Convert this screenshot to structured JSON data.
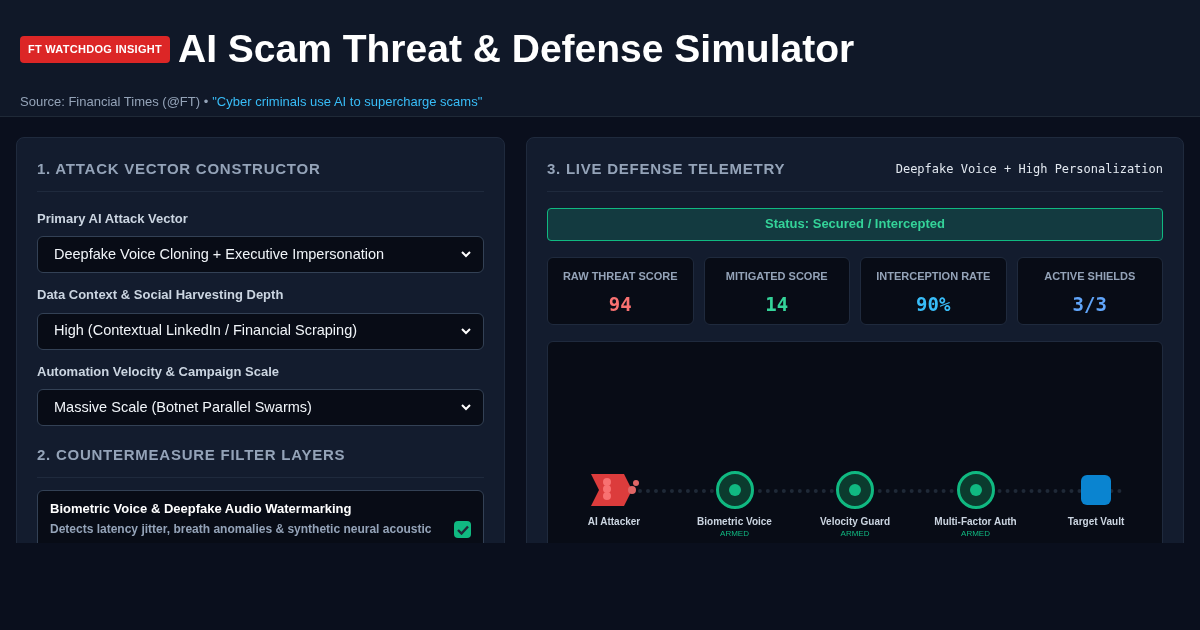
{
  "header": {
    "badge": "FT WATCHDOG INSIGHT",
    "title": "AI Scam Threat & Defense Simulator",
    "source": "Source: Financial Times (@FT) •",
    "source_link": "\"Cyber criminals use AI to supercharge scams\""
  },
  "constructor": {
    "title": "1. ATTACK VECTOR CONSTRUCTOR",
    "fields": [
      {
        "label": "Primary AI Attack Vector",
        "value": "Deepfake Voice Cloning + Executive Impersonation"
      },
      {
        "label": "Data Context & Social Harvesting Depth",
        "value": "High (Contextual LinkedIn / Financial Scraping)"
      },
      {
        "label": "Automation Velocity & Campaign Scale",
        "value": "Massive Scale (Botnet Parallel Swarms)"
      }
    ]
  },
  "filters": {
    "title": "2. COUNTERMEASURE FILTER LAYERS",
    "items": [
      {
        "name": "Biometric Voice & Deepfake Audio Watermarking",
        "description": "Detects latency jitter, breath anomalies & synthetic neural acoustic",
        "checked": true
      }
    ]
  },
  "telemetry": {
    "title": "3. LIVE DEFENSE TELEMETRY",
    "scenario": "Deepfake Voice + High Personalization",
    "status": "Status: Secured / Intercepted",
    "secured": true,
    "metrics": [
      {
        "label": "RAW THREAT SCORE",
        "value": "94",
        "color": "#f87171"
      },
      {
        "label": "MITIGATED SCORE",
        "value": "14",
        "color": "#34d399"
      },
      {
        "label": "INTERCEPTION RATE",
        "value": "90%",
        "color": "#38bdf8"
      },
      {
        "label": "ACTIVE SHIELDS",
        "value": "3/3",
        "color": "#60a5fa"
      }
    ],
    "nodes": [
      {
        "kind": "attacker",
        "label": "AI Attacker"
      },
      {
        "kind": "shield",
        "label": "Biometric Voice",
        "status": "ARMED"
      },
      {
        "kind": "shield",
        "label": "Velocity Guard",
        "status": "ARMED"
      },
      {
        "kind": "shield",
        "label": "Multi-Factor Auth",
        "status": "ARMED"
      },
      {
        "kind": "vault",
        "label": "Target Vault"
      }
    ]
  }
}
